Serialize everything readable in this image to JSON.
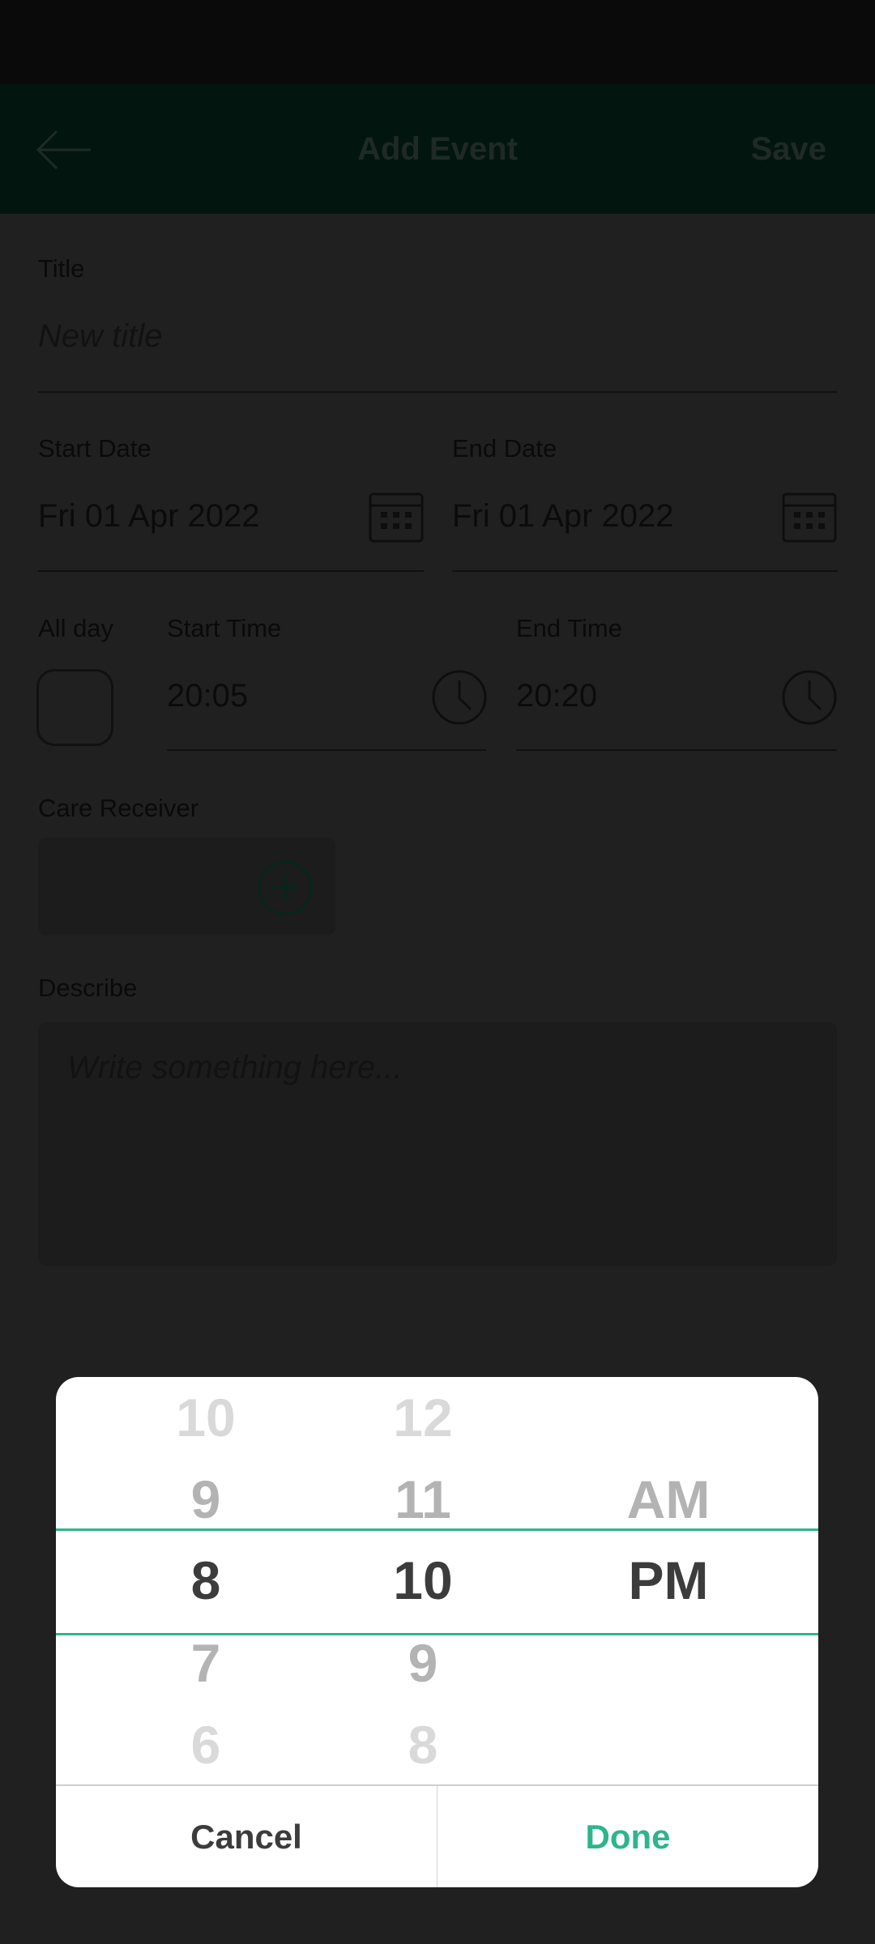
{
  "header": {
    "title": "Add Event",
    "save_label": "Save"
  },
  "form": {
    "title_label": "Title",
    "title_placeholder": "New title",
    "start_date_label": "Start Date",
    "start_date": "Fri 01 Apr 2022",
    "end_date_label": "End Date",
    "end_date": "Fri 01 Apr 2022",
    "all_day_label": "All day",
    "start_time_label": "Start Time",
    "start_time": "20:05",
    "end_time_label": "End Time",
    "end_time": "20:20",
    "care_receiver_label": "Care Receiver",
    "describe_label": "Describe",
    "describe_placeholder": "Write something here..."
  },
  "picker": {
    "hours": [
      "10",
      "9",
      "8",
      "7",
      "6"
    ],
    "minutes": [
      "12",
      "11",
      "10",
      "9",
      "8"
    ],
    "ampm": [
      "AM",
      "PM"
    ],
    "selected": {
      "hour": "8",
      "minute": "10",
      "period": "PM"
    },
    "cancel_label": "Cancel",
    "done_label": "Done",
    "accent": "#2db58c"
  }
}
